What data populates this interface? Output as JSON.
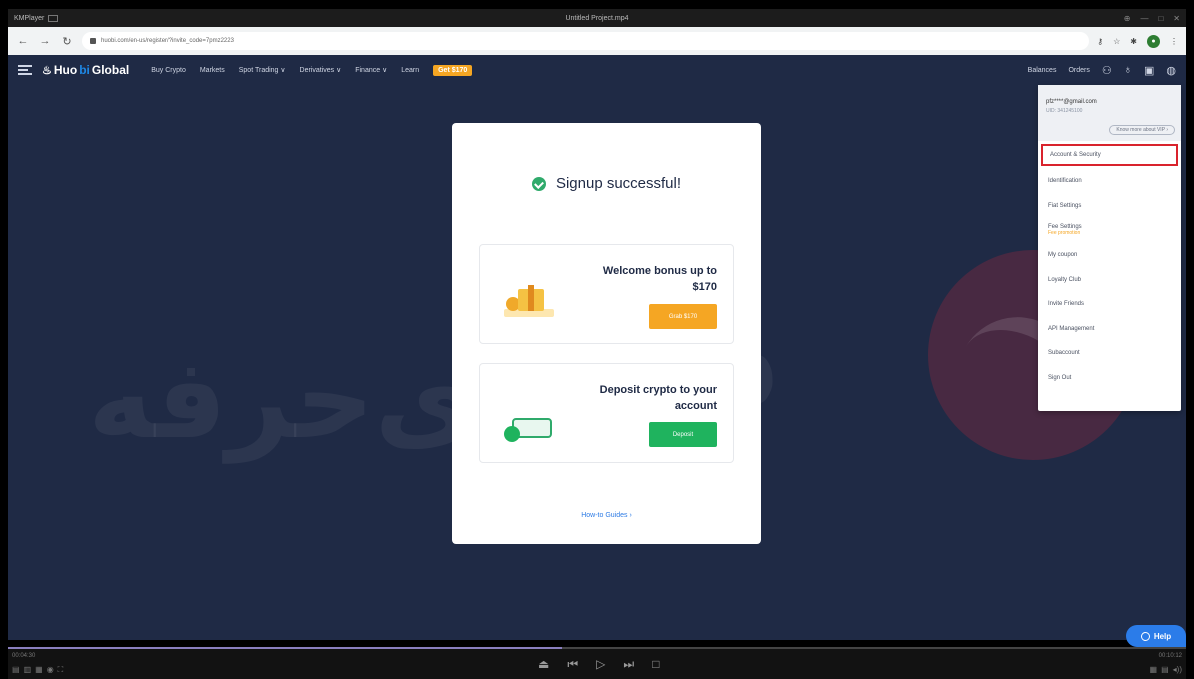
{
  "player": {
    "app_name": "KMPlayer",
    "file_name": "Untitled Project.mp4",
    "window_controls": [
      "⊕",
      "—",
      "□",
      "✕"
    ],
    "time_elapsed": "00:04:30",
    "time_total": "00:10:12",
    "progress": 0.47
  },
  "browser": {
    "url": "huobi.com/en-us/register/?invite_code=7pmz2223"
  },
  "nav": {
    "logo_part1": "Huo",
    "logo_part2": "bi",
    "logo_part3": " Global",
    "links": [
      "Buy Crypto",
      "Markets",
      "Spot Trading ∨",
      "Derivatives ∨",
      "Finance ∨",
      "Learn"
    ],
    "promo": "Get $170",
    "balances": "Balances",
    "orders": "Orders"
  },
  "card": {
    "title": "Signup successful!",
    "bonus_text": "Welcome bonus up to $170",
    "bonus_button": "Grab $170",
    "deposit_text": "Deposit crypto to your account",
    "deposit_button": "Deposit",
    "guides_link": "How-to Guides ›"
  },
  "dropdown": {
    "email": "pfz****@gmail.com",
    "uid": "UID: 341245100",
    "vip": "Know more about VIP ›",
    "items": [
      {
        "label": "Account & Security"
      },
      {
        "label": "Identification"
      },
      {
        "label": "Fiat Settings"
      },
      {
        "label": "Fee Settings",
        "sub": "Fee promotion"
      },
      {
        "label": "My coupon"
      },
      {
        "label": "Loyalty Club"
      },
      {
        "label": "Invite Friends"
      },
      {
        "label": "API Management"
      },
      {
        "label": "Subaccount"
      },
      {
        "label": "Sign Out"
      }
    ]
  },
  "help": {
    "label": "Help"
  },
  "colors": {
    "nav_bg": "#1f2a45",
    "accent_orange": "#f5a623",
    "accent_green": "#1fb35e",
    "highlight_red": "#d9232d",
    "help_blue": "#2b7ce9"
  }
}
